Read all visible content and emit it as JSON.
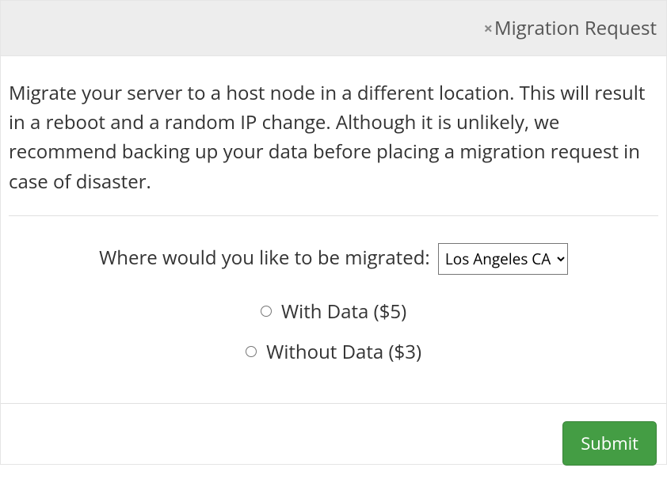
{
  "header": {
    "title": "Migration Request"
  },
  "body": {
    "description": "Migrate your server to a host node in a different location. This will result in a reboot and a random IP change. Although it is unlikely, we recommend backing up your data before placing a migration request in case of disaster.",
    "prompt_label": "Where would you like to be migrated:",
    "location_selected": "Los Angeles CA",
    "options": {
      "with_data": "With Data ($5)",
      "without_data": "Without Data ($3)"
    }
  },
  "footer": {
    "submit_label": "Submit"
  }
}
